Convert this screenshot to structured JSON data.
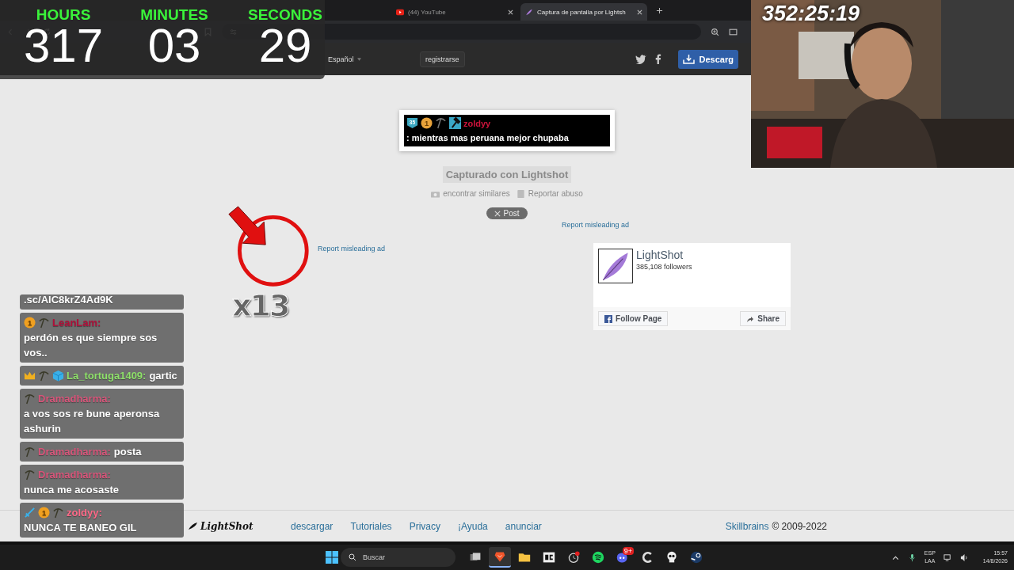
{
  "browser": {
    "tabs": [
      {
        "title": "(44) YouTube",
        "selected": false
      },
      {
        "title": "Captura de pantalla por Lightsh",
        "selected": true
      }
    ]
  },
  "site_header": {
    "language": "Español",
    "register": "registrarse",
    "download": "Descarg"
  },
  "screenshot_image": {
    "badges": [
      {
        "kind": "sub",
        "text": "35"
      },
      {
        "kind": "coin",
        "text": "1"
      },
      {
        "kind": "pickaxe"
      },
      {
        "kind": "hammer"
      }
    ],
    "user": "zoldyy",
    "color": "#d0143c",
    "text": ": mientras mas peruana mejor chupaba"
  },
  "capture": {
    "caption": "Capturado con Lightshot",
    "links": [
      {
        "label": "encontrar similares"
      },
      {
        "label": "Reportar abuso"
      }
    ],
    "post": "Post"
  },
  "ad": {
    "overlay_text": "x13",
    "report_link": "Report misleading ad"
  },
  "facebook_widget": {
    "report_link": "Report misleading ad",
    "page": "LightShot",
    "followers": "385,108 followers",
    "follow": "Follow Page",
    "share": "Share"
  },
  "footer": {
    "logo": "LightShot",
    "links": [
      "descargar",
      "Tutoriales",
      "Privacy",
      "¡Ayuda",
      "anunciar"
    ],
    "company": "Skillbrains",
    "copyright": "© 2009-2022"
  },
  "stream_timer": {
    "units": [
      {
        "label": "HOURS",
        "value": "317"
      },
      {
        "label": "MINUTES",
        "value": "03"
      },
      {
        "label": "SECONDS",
        "value": "29"
      }
    ]
  },
  "webcam": {
    "timer": "352:25:19"
  },
  "chat": {
    "cut_text": ".sc/AlC8krZ4Ad9K",
    "messages": [
      {
        "badges": [
          {
            "kind": "coin",
            "text": "1"
          },
          {
            "kind": "pickaxe"
          }
        ],
        "user": "LeanLam:",
        "color": "#b0103a",
        "text": "perdón es que siempre sos vos.."
      },
      {
        "badges": [
          {
            "kind": "crown"
          },
          {
            "kind": "pickaxe"
          },
          {
            "kind": "cube"
          }
        ],
        "user": "La_tortuga1409:",
        "color": "#8ee06a",
        "text": "gartic"
      },
      {
        "badges": [
          {
            "kind": "pickaxe"
          }
        ],
        "user": "Dramadharma:",
        "color": "#d8557a",
        "text": "a vos sos re bune aperonsa ashurin"
      },
      {
        "badges": [
          {
            "kind": "pickaxe"
          }
        ],
        "user": "Dramadharma:",
        "color": "#d8557a",
        "text": "posta"
      },
      {
        "badges": [
          {
            "kind": "pickaxe"
          }
        ],
        "user": "Dramadharma:",
        "color": "#d8557a",
        "text": "nunca me acosaste"
      },
      {
        "badges": [
          {
            "kind": "sword"
          },
          {
            "kind": "coin",
            "text": "1"
          },
          {
            "kind": "pickaxe"
          }
        ],
        "user": "zoldyy:",
        "color": "#ff6a88",
        "text": "NUNCA TE BANEO GIL"
      }
    ]
  },
  "taskbar": {
    "search": "Buscar",
    "apps": [
      {
        "kind": "task-view",
        "selected": false
      },
      {
        "kind": "brave",
        "selected": true
      },
      {
        "kind": "folder",
        "selected": false
      },
      {
        "kind": "dc",
        "selected": false
      },
      {
        "kind": "clock",
        "selected": false,
        "alert": true
      },
      {
        "kind": "spotify",
        "selected": false
      },
      {
        "kind": "discord",
        "selected": false,
        "badge": "9+"
      },
      {
        "kind": "ccleaner",
        "selected": false
      },
      {
        "kind": "skull",
        "selected": false
      },
      {
        "kind": "steam",
        "selected": false
      }
    ],
    "language": "ESP",
    "layout": "LAA",
    "time": "15:57",
    "date": "14/8/2026"
  }
}
